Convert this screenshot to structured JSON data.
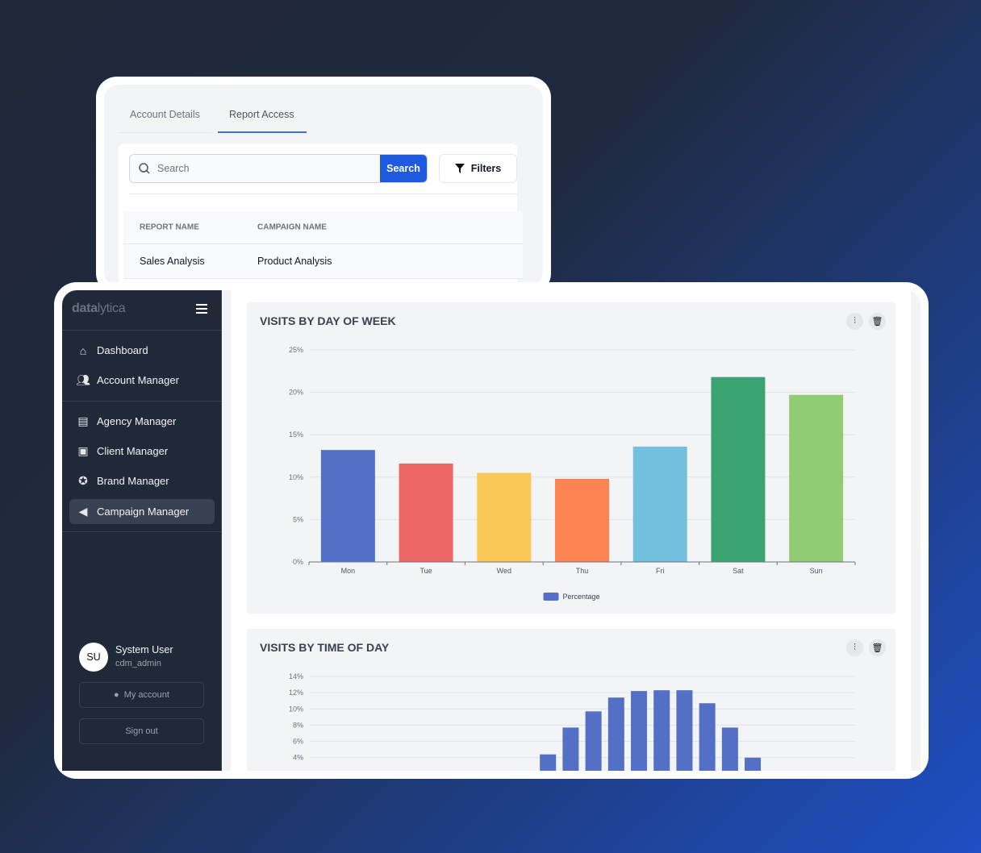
{
  "back_panel": {
    "tabs": [
      {
        "label": "Account Details",
        "active": false
      },
      {
        "label": "Report Access",
        "active": true
      }
    ],
    "search": {
      "placeholder": "Search",
      "button": "Search"
    },
    "filters_label": "Filters",
    "table": {
      "columns": [
        "REPORT NAME",
        "CAMPAIGN NAME"
      ],
      "rows": [
        [
          "Sales Analysis",
          "Product Analysis"
        ]
      ]
    }
  },
  "sidebar": {
    "logo": {
      "bold": "data",
      "light": "lytica"
    },
    "items": [
      {
        "label": "Dashboard",
        "icon": "home-icon",
        "active": false
      },
      {
        "label": "Account Manager",
        "icon": "users-icon",
        "active": false
      },
      {
        "label": "Agency Manager",
        "icon": "presentation-icon",
        "active": false
      },
      {
        "label": "Client Manager",
        "icon": "briefcase-icon",
        "active": false
      },
      {
        "label": "Brand Manager",
        "icon": "award-icon",
        "active": false
      },
      {
        "label": "Campaign Manager",
        "icon": "megaphone-icon",
        "active": true
      }
    ],
    "user": {
      "initials": "SU",
      "name": "System User",
      "role": "cdm_admin"
    },
    "my_account": "My account",
    "sign_out": "Sign out"
  },
  "colors": {
    "accent": "#1d5ae0",
    "sidebar": "#1f2937"
  },
  "chart_data": [
    {
      "type": "bar",
      "title": "VISITS BY DAY OF WEEK",
      "categories": [
        "Mon",
        "Tue",
        "Wed",
        "Thu",
        "Fri",
        "Sat",
        "Sun"
      ],
      "series": [
        {
          "name": "Percentage",
          "values": [
            13.2,
            11.6,
            10.5,
            9.8,
            13.6,
            21.8,
            19.7
          ],
          "colors": [
            "#5470c6",
            "#ee6666",
            "#fac858",
            "#fc8452",
            "#73c0de",
            "#3ba272",
            "#91cc75"
          ]
        }
      ],
      "ylim": [
        0,
        25
      ],
      "yticks": [
        "0%",
        "5%",
        "10%",
        "15%",
        "20%",
        "25%"
      ],
      "ytick_values": [
        0,
        5,
        10,
        15,
        20,
        25
      ],
      "grid": true,
      "legend": "bottom"
    },
    {
      "type": "bar",
      "title": "VISITS BY TIME OF DAY",
      "series": [
        {
          "values": [
            null,
            null,
            null,
            null,
            null,
            null,
            null,
            null,
            null,
            null,
            4.4,
            7.7,
            9.7,
            11.4,
            12.2,
            12.3,
            12.3,
            10.7,
            7.7,
            4.0,
            null,
            null,
            null,
            null
          ],
          "color": "#5470c6"
        }
      ],
      "ylim": [
        0,
        14
      ],
      "yticks": [
        "4%",
        "6%",
        "8%",
        "10%",
        "12%",
        "14%"
      ],
      "ytick_values": [
        4,
        6,
        8,
        10,
        12,
        14
      ],
      "grid": true
    }
  ]
}
